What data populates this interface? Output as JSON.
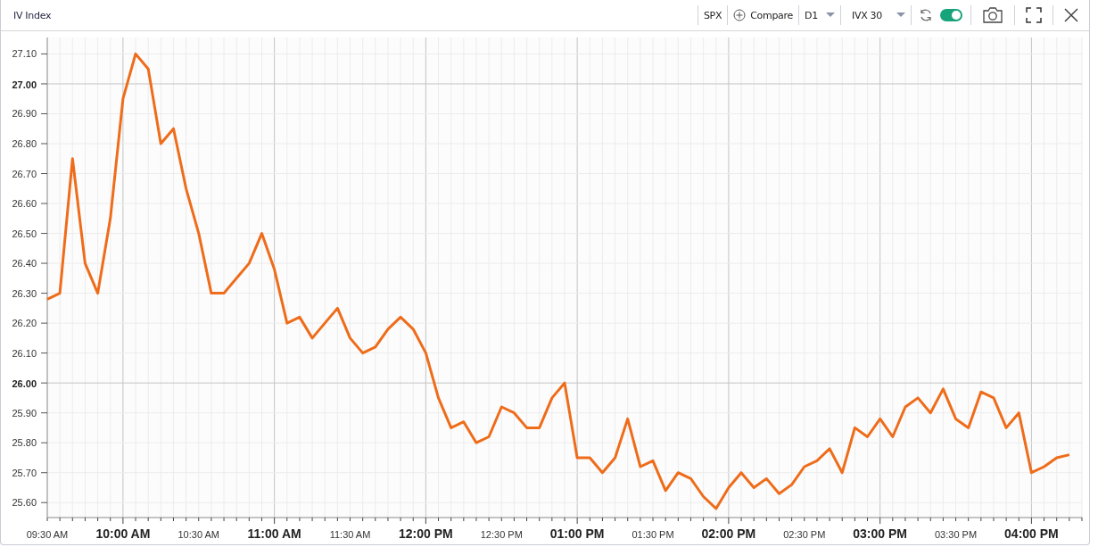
{
  "window": {
    "title": "IV Index"
  },
  "toolbar": {
    "symbol": "SPX",
    "compare": "Compare",
    "interval": "D1",
    "measure": "IVX 30",
    "auto_refresh": {
      "on": true
    }
  },
  "chart": {
    "chart_data": {
      "type": "line",
      "categories": [
        "09:30 AM",
        null,
        null,
        null,
        null,
        null,
        "10:00 AM",
        null,
        null,
        null,
        null,
        null,
        "10:30 AM",
        null,
        null,
        null,
        null,
        null,
        "11:00 AM",
        null,
        null,
        null,
        null,
        null,
        "11:30 AM",
        null,
        null,
        null,
        null,
        null,
        "12:00 PM",
        null,
        null,
        null,
        null,
        null,
        "12:30 PM",
        null,
        null,
        null,
        null,
        null,
        "01:00 PM",
        null,
        null,
        null,
        null,
        null,
        "01:30 PM",
        null,
        null,
        null,
        null,
        null,
        "02:00 PM",
        null,
        null,
        null,
        null,
        null,
        "02:30 PM",
        null,
        null,
        null,
        null,
        null,
        "03:00 PM",
        null,
        null,
        null,
        null,
        null,
        "03:30 PM",
        null,
        null,
        null,
        null,
        null,
        "04:00 PM",
        null,
        null,
        null
      ],
      "series": [
        {
          "color": "#ee6c1a",
          "values": [
            26.28,
            26.3,
            26.75,
            26.4,
            26.3,
            26.55,
            26.95,
            27.1,
            27.05,
            26.8,
            26.85,
            26.65,
            26.5,
            26.3,
            26.3,
            26.35,
            26.4,
            26.5,
            26.38,
            26.2,
            26.22,
            26.15,
            26.2,
            26.25,
            26.15,
            26.1,
            26.12,
            26.18,
            26.22,
            26.18,
            26.1,
            25.95,
            25.85,
            25.87,
            25.8,
            25.82,
            25.92,
            25.9,
            25.85,
            25.85,
            25.95,
            26.0,
            25.75,
            25.75,
            25.7,
            25.75,
            25.88,
            25.72,
            25.74,
            25.64,
            25.7,
            25.68,
            25.62,
            25.58,
            25.65,
            25.7,
            25.65,
            25.68,
            25.63,
            25.66,
            25.72,
            25.74,
            25.78,
            25.7,
            25.85,
            25.82,
            25.88,
            25.82,
            25.92,
            25.95,
            25.9,
            25.98,
            25.88,
            25.85,
            25.97,
            25.95,
            25.85,
            25.9,
            25.7,
            25.72,
            25.75,
            25.76
          ]
        }
      ],
      "ylim": [
        25.55,
        27.155
      ],
      "grid": true,
      "yticks": [
        {
          "value": 25.6,
          "label": "25.60"
        },
        {
          "value": 25.7,
          "label": "25.70"
        },
        {
          "value": 25.8,
          "label": "25.80"
        },
        {
          "value": 25.9,
          "label": "25.90"
        },
        {
          "value": 26.0,
          "label": "26.00"
        },
        {
          "value": 26.1,
          "label": "26.10"
        },
        {
          "value": 26.2,
          "label": "26.20"
        },
        {
          "value": 26.3,
          "label": "26.30"
        },
        {
          "value": 26.4,
          "label": "26.40"
        },
        {
          "value": 26.5,
          "label": "26.50"
        },
        {
          "value": 26.6,
          "label": "26.60"
        },
        {
          "value": 26.7,
          "label": "26.70"
        },
        {
          "value": 26.8,
          "label": "26.80"
        },
        {
          "value": 26.9,
          "label": "26.90"
        },
        {
          "value": 27.0,
          "label": "27.00"
        },
        {
          "value": 27.1,
          "label": "27.10"
        }
      ]
    }
  }
}
